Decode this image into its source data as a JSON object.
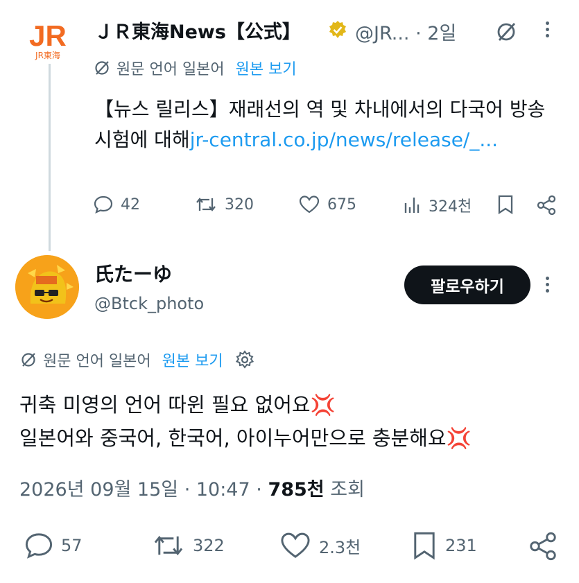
{
  "tweet1": {
    "author_name": "ＪＲ東海News【公式】",
    "handle": "@JR...",
    "time": "· 2일",
    "translation_note": "원문 언어 일본어",
    "view_original": "원본 보기",
    "text": "【뉴스 릴리스】재래선의 역 및 차내에서의 다국어 방송 시험에 대해",
    "link": "jr-central.co.jp/news/release/_...",
    "logo_text": "JR",
    "logo_sub": "JR東海",
    "stats": {
      "replies": "42",
      "retweets": "320",
      "likes": "675",
      "views": "324천"
    }
  },
  "tweet2": {
    "author_name": "氏たーゆ",
    "handle": "@Btck_photo",
    "follow_label": "팔로우하기",
    "translation_note": "원문 언어 일본어",
    "view_original": "원본 보기",
    "line1": "귀축 미영의 언어 따윈 필요 없어요💢",
    "line2": "일본어와 중국어, 한국어, 아이누어만으로 충분해요💢",
    "date": "2026년 09월 15일 · 10:47 ·",
    "views_count": "785천",
    "views_label": "조회",
    "stats": {
      "replies": "57",
      "retweets": "322",
      "likes": "2.3천",
      "bookmarks": "231"
    }
  },
  "colors": {
    "link": "#1d9bf0",
    "muted": "#536471",
    "logo": "#f26b22",
    "verified": "#e2b719"
  }
}
